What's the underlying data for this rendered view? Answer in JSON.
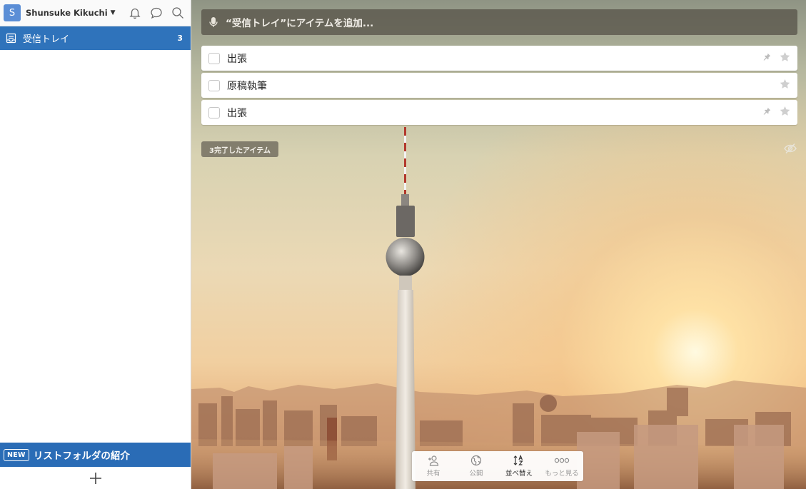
{
  "user": {
    "initial": "S",
    "name": "Shunsuke Kikuchi",
    "caret": "▼"
  },
  "top_icons": [
    "bell-icon",
    "chat-bubble-icon",
    "search-icon"
  ],
  "sidebar": {
    "lists": [
      {
        "label": "受信トレイ",
        "count": "3",
        "icon": "inbox-icon",
        "selected": true
      }
    ],
    "promo": {
      "badge": "NEW",
      "text": "リストフォルダの紹介"
    },
    "add_icon": "plus-icon"
  },
  "main": {
    "add_placeholder": "“受信トレイ”にアイテムを追加...",
    "tasks": [
      {
        "title": "出張",
        "pinned": true,
        "starred": false
      },
      {
        "title": "原稿執筆",
        "pinned": false,
        "starred": false
      },
      {
        "title": "出張",
        "pinned": true,
        "starred": false
      }
    ],
    "completed_label": "3完了したアイテム"
  },
  "toolbar": {
    "items": [
      {
        "label": "共有",
        "icon": "add-person-icon"
      },
      {
        "label": "公開",
        "icon": "globe-icon"
      },
      {
        "label": "並べ替え",
        "icon": "sort-az-icon"
      },
      {
        "label": "もっと見る",
        "icon": "more-icon"
      }
    ]
  },
  "colors": {
    "sidebar_selected": "#2f73bb",
    "promo": "#2a6cb6",
    "avatar": "#5b8ed6"
  }
}
